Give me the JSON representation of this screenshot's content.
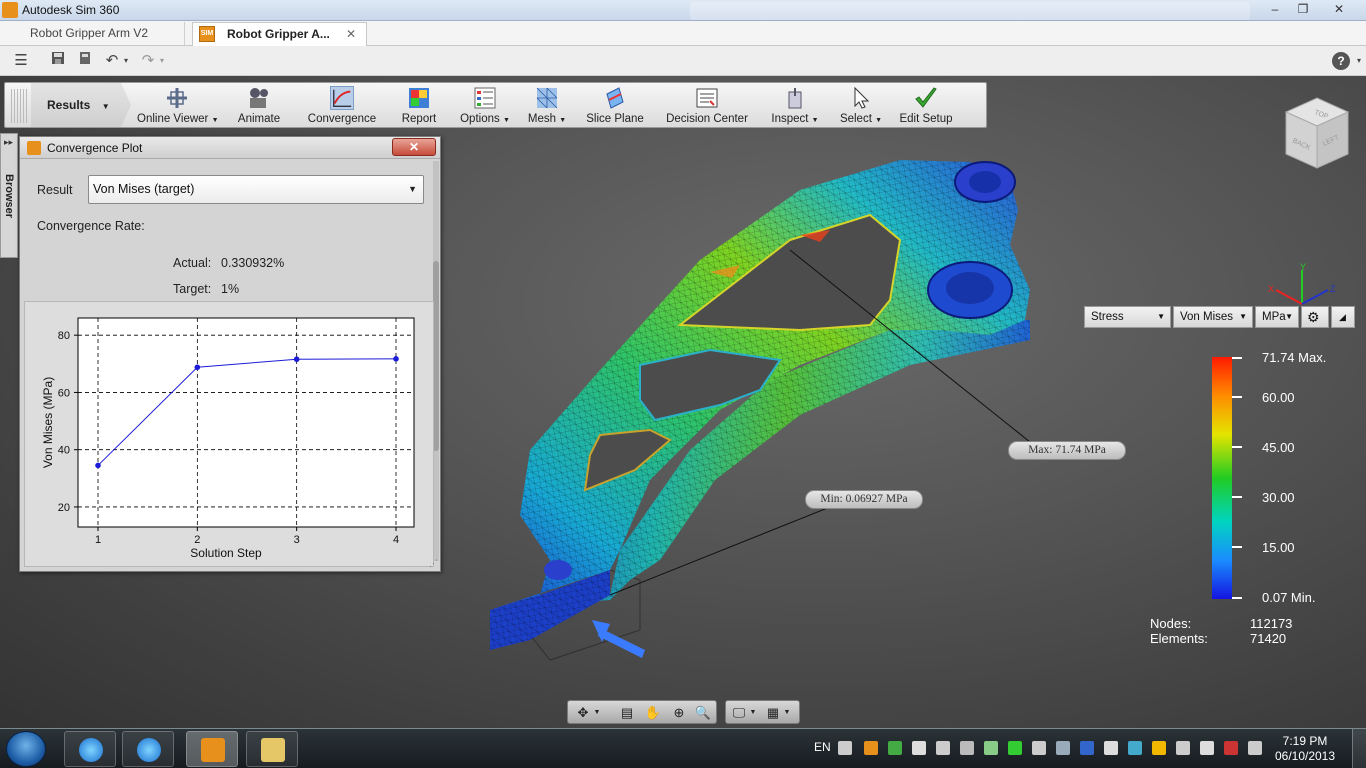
{
  "window": {
    "title": "Autodesk Sim 360",
    "controls": [
      "‒",
      "❐",
      "✕"
    ]
  },
  "tabs": [
    {
      "label": "Robot Gripper Arm V2"
    },
    {
      "label": "Robot Gripper A..."
    }
  ],
  "ribbon": {
    "mode_label": "Results",
    "buttons": [
      {
        "label": "Online Viewer",
        "dropdown": true,
        "icon": "online-viewer-icon"
      },
      {
        "label": "Animate",
        "icon": "film-camera-icon"
      },
      {
        "label": "Convergence",
        "icon": "convergence-chart-icon",
        "active": true
      },
      {
        "label": "Report",
        "icon": "report-icon"
      },
      {
        "label": "Options",
        "dropdown": true,
        "icon": "options-list-icon"
      },
      {
        "label": "Mesh",
        "dropdown": true,
        "icon": "mesh-icon"
      },
      {
        "label": "Slice Plane",
        "icon": "slice-plane-icon"
      },
      {
        "label": "Decision Center",
        "icon": "decision-center-icon"
      },
      {
        "label": "Inspect",
        "dropdown": true,
        "icon": "inspect-icon"
      },
      {
        "label": "Select",
        "dropdown": true,
        "icon": "cursor-arrow-icon"
      },
      {
        "label": "Edit Setup",
        "icon": "green-check-icon"
      }
    ]
  },
  "browser_panel": {
    "label": "Browser"
  },
  "convergence_dialog": {
    "title": "Convergence Plot",
    "result_label": "Result",
    "result_value": "Von Mises (target)",
    "rate_label": "Convergence Rate:",
    "actual_label": "Actual:",
    "actual_value": "0.330932%",
    "target_label": "Target:",
    "target_value": "1%"
  },
  "chart_data": {
    "type": "line",
    "title": "",
    "xlabel": "Solution Step",
    "ylabel": "Von Mises (MPa)",
    "x": [
      1,
      2,
      3,
      4
    ],
    "series": [
      {
        "values": [
          34.5,
          68.8,
          71.6,
          71.74
        ],
        "color": "#1b1bd8"
      }
    ],
    "xlim": [
      1,
      4
    ],
    "ylim": [
      13,
      86
    ],
    "xticks": [
      1,
      2,
      3,
      4
    ],
    "yticks": [
      20,
      40,
      60,
      80
    ],
    "grid": true,
    "grid_style": "dashed"
  },
  "annotations": {
    "min_label": "Min: 0.06927 MPa",
    "max_label": "Max: 71.74 MPa"
  },
  "result_controls": {
    "type": "Stress",
    "component": "Von Mises",
    "unit": "MPa"
  },
  "legend": {
    "labels": [
      "71.74 Max.",
      "60.00",
      "45.00",
      "30.00",
      "15.00",
      "0.07 Min."
    ],
    "max_value": 71.74,
    "min_value": 0.07
  },
  "mesh_stats": {
    "nodes_label": "Nodes:",
    "nodes_value": "112173",
    "elements_label": "Elements:",
    "elements_value": "71420"
  },
  "viewcube": {
    "faces": [
      "BACK",
      "LEFT",
      "TOP"
    ]
  },
  "triad": {
    "axes": [
      "X",
      "Y",
      "Z"
    ]
  },
  "taskbar": {
    "language": "EN",
    "time": "7:19 PM",
    "date": "06/10/2013"
  },
  "colors": {
    "accent": "#e8901c",
    "plot_line": "#1b1bd8",
    "close_button": "#c74b3a"
  }
}
